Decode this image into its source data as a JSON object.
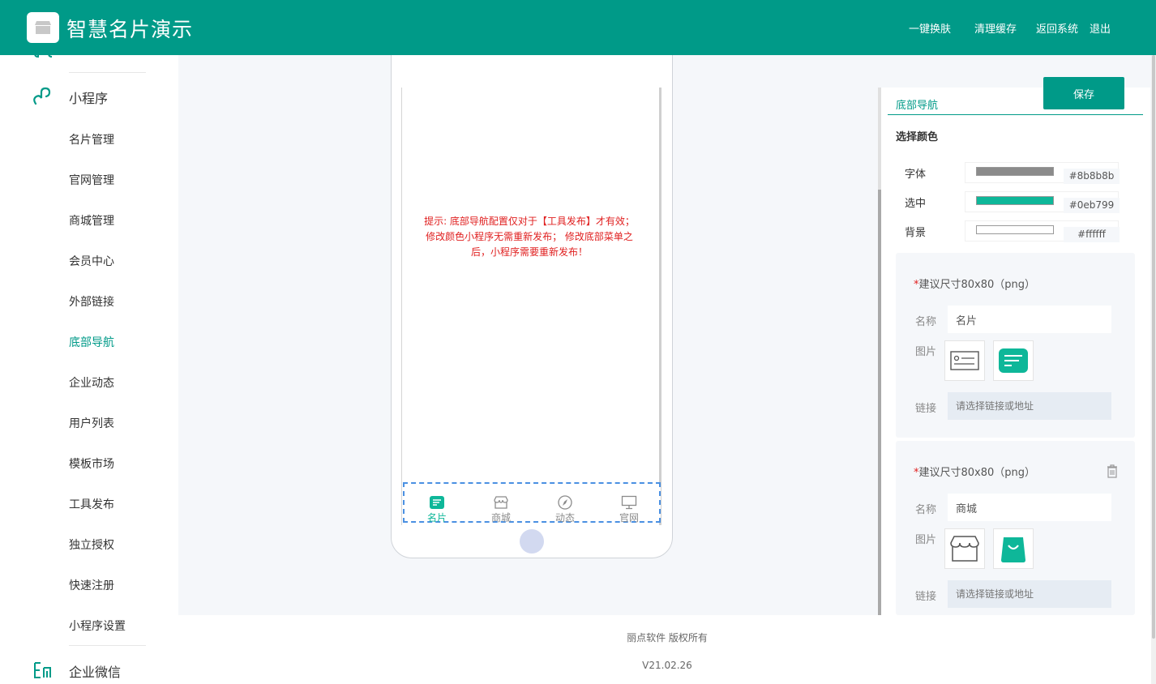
{
  "header": {
    "title": "智慧名片演示",
    "links": [
      "一键换肤",
      "清理缓存",
      "返回系统",
      "退出"
    ]
  },
  "sidebar": {
    "groups": [
      {
        "label": "小程序",
        "icon": "miniprogram-icon"
      },
      {
        "label": "企业微信",
        "icon": "enterprise-wechat-icon"
      }
    ],
    "items": [
      "名片管理",
      "官网管理",
      "商城管理",
      "会员中心",
      "外部链接",
      "底部导航",
      "企业动态",
      "用户列表",
      "模板市场",
      "工具发布",
      "独立授权",
      "快速注册",
      "小程序设置"
    ],
    "active_item": "底部导航"
  },
  "preview": {
    "notice": "提示: 底部导航配置仅对于【工具发布】才有效；修改颜色小程序无需重新发布； 修改底部菜单之后，小程序需要重新发布！",
    "tabs": [
      {
        "label": "名片",
        "icon": "card-icon",
        "active": true
      },
      {
        "label": "商城",
        "icon": "shop-icon",
        "active": false
      },
      {
        "label": "动态",
        "icon": "compass-icon",
        "active": false
      },
      {
        "label": "官网",
        "icon": "monitor-icon",
        "active": false
      }
    ]
  },
  "panel": {
    "save_label": "保存",
    "active_tab": "底部导航",
    "section_title": "选择颜色",
    "colors": [
      {
        "label": "字体",
        "value": "#8b8b8b"
      },
      {
        "label": "选中",
        "value": "#0eb799"
      },
      {
        "label": "背景",
        "value": "#ffffff"
      }
    ],
    "cards": [
      {
        "hint": "建议尺寸80x80（png）",
        "name_label": "名称",
        "name_value": "名片",
        "image_label": "图片",
        "link_label": "链接",
        "link_placeholder": "请选择链接或地址",
        "icons": [
          "card-outline-icon",
          "card-filled-icon"
        ]
      },
      {
        "hint": "建议尺寸80x80（png）",
        "name_label": "名称",
        "name_value": "商城",
        "image_label": "图片",
        "link_label": "链接",
        "link_placeholder": "请选择链接或地址",
        "icons": [
          "shop-outline-icon",
          "shop-bag-filled-icon"
        ]
      }
    ]
  },
  "footer": {
    "copyright": "丽点软件 版权所有",
    "version": "V21.02.26"
  },
  "colors": {
    "brand": "#009a88",
    "tab_font": "#8b8b8b",
    "tab_selected": "#0eb799",
    "notice": "#e02020"
  }
}
